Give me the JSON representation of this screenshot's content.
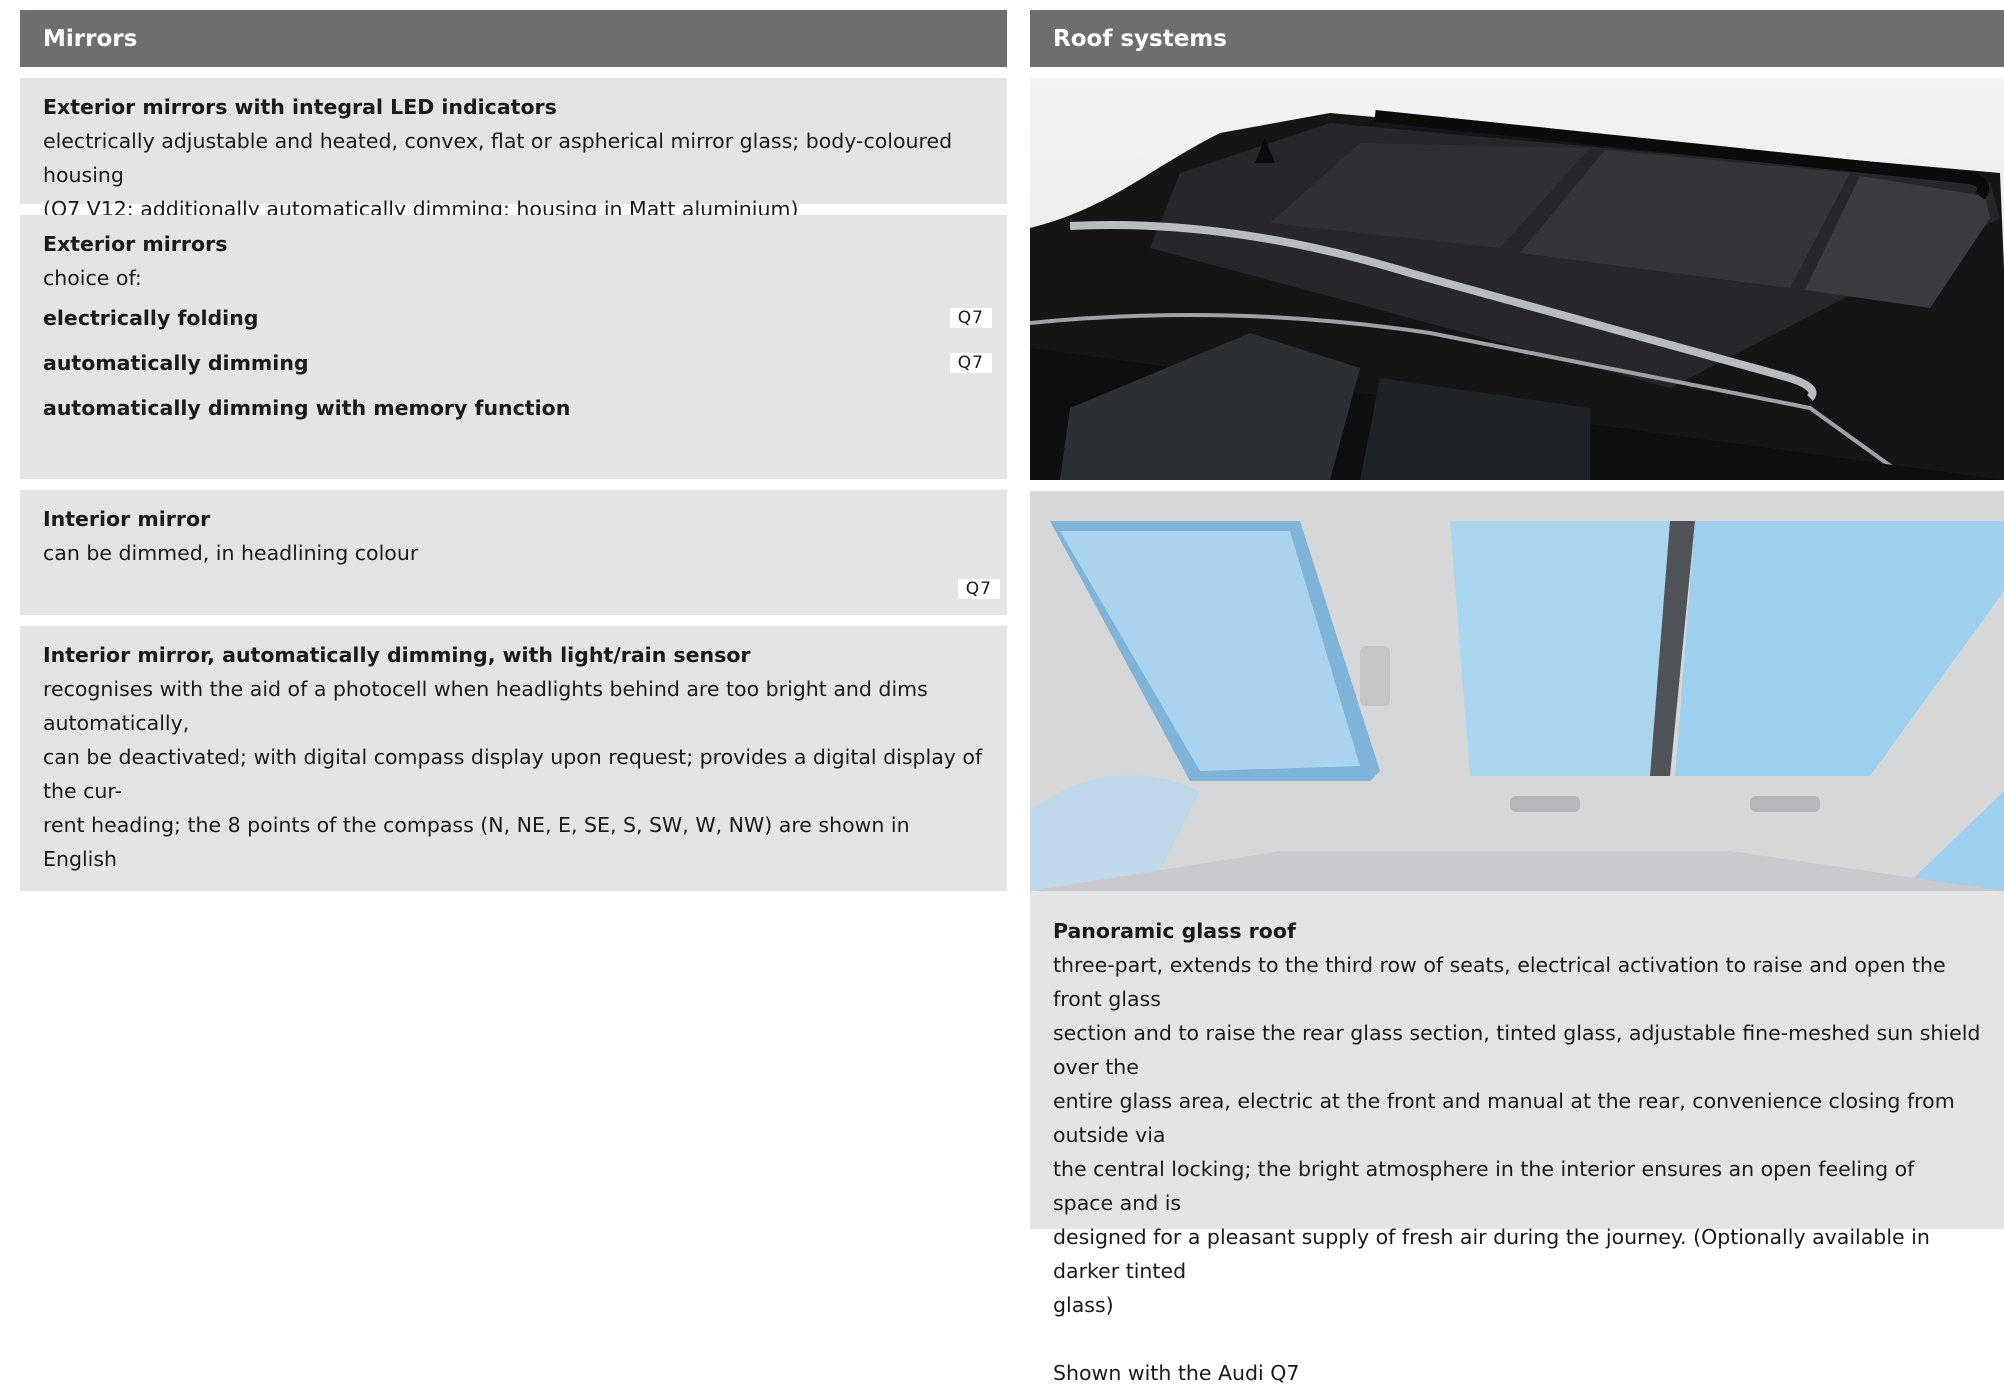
{
  "headers": {
    "left": "Mirrors",
    "right": "Roof systems"
  },
  "mirrors": {
    "led": {
      "title": "Exterior mirrors with integral LED indicators",
      "desc": "electrically adjustable and heated, convex, flat or aspherical mirror glass; body-coloured housing",
      "desc2": "(Q7 V12: additionally  automatically dimming; housing in Matt aluminium)"
    },
    "exterior": {
      "title": "Exterior mirrors",
      "subtitle": "choice of:",
      "options": [
        {
          "label": "electrically folding",
          "tag": "Q7"
        },
        {
          "label": "automatically dimming",
          "tag": "Q7"
        },
        {
          "label": "automatically dimming with memory function",
          "tag": ""
        }
      ]
    },
    "interior": {
      "title": "Interior mirror",
      "desc": "can be dimmed, in headlining colour",
      "tag": "Q7"
    },
    "auto": {
      "title": "Interior mirror, automatically dimming, with light/rain sensor",
      "lines": [
        "recognises with the aid of a photocell when headlights behind are too bright and dims automatically,",
        "can be deactivated; with digital compass display upon request; provides a digital display of the cur-",
        "rent heading; the 8 points of the compass (N, NE, E, SE, S, SW, W, NW) are shown in English"
      ]
    }
  },
  "roof": {
    "title": "Panoramic glass roof",
    "lines": [
      "three-part, extends to the third row of seats, electrical activation to raise and open the front glass",
      "section and to raise the rear glass section, tinted glass, adjustable fine-meshed sun shield over the",
      "entire glass area, electric at the front and manual at the rear, convenience closing from outside via",
      "the central locking; the bright atmosphere in the interior ensures an open feeling of space and is",
      "designed for a pleasant supply of fresh air during the journey. (Optionally available in darker tinted",
      "glass)"
    ],
    "caption": "Shown with the Audi Q7"
  },
  "images": {
    "exterior_photo": "car-roof-exterior-photo",
    "interior_photo": "panoramic-roof-interior-photo"
  }
}
